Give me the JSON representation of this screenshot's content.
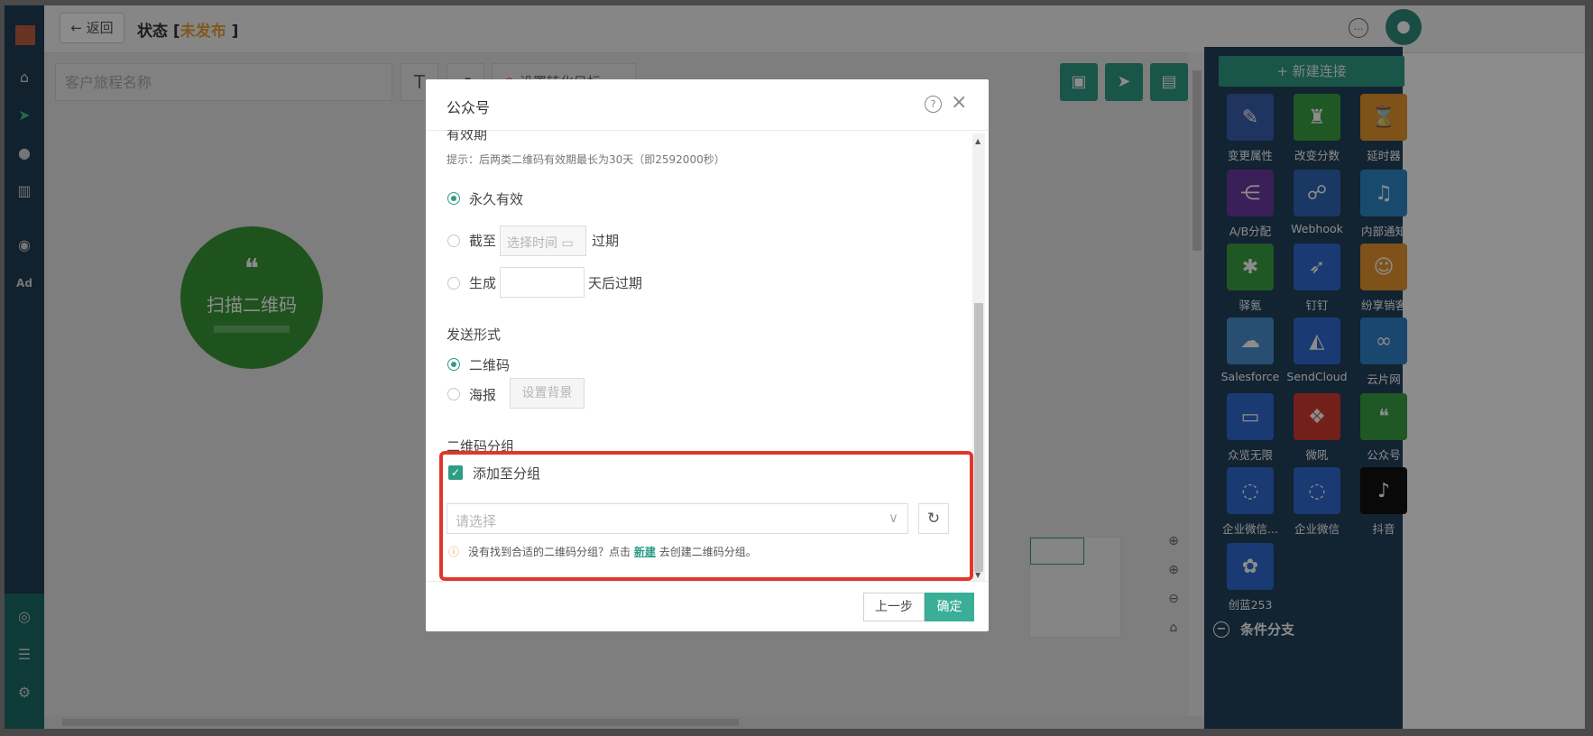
{
  "topbar": {
    "back_label": "返回",
    "status_prefix": "状态 [",
    "status_value": "未发布",
    "status_suffix": "]"
  },
  "toolbar": {
    "journey_name_placeholder": "客户旅程名称",
    "text_tool": "T",
    "goal_label": "设置转化目标"
  },
  "canvas": {
    "node_label": "扫描二维码"
  },
  "right_panel": {
    "new_connection": "+ 新建连接",
    "tiles": [
      {
        "name": "变更属性",
        "color": "#3b5fb0",
        "icon": "edit-icon"
      },
      {
        "name": "改变分数",
        "color": "#3aa043",
        "icon": "trophy-icon"
      },
      {
        "name": "延时器",
        "color": "#e6962c",
        "icon": "hourglass-icon"
      },
      {
        "name": "A/B分配",
        "color": "#6a3aa3",
        "icon": "ab-split-icon"
      },
      {
        "name": "Webhook",
        "color": "#2e66b4",
        "icon": "webhook-icon"
      },
      {
        "name": "内部通知",
        "color": "#2d88c8",
        "icon": "bell-icon"
      },
      {
        "name": "驿氪",
        "color": "#3aa043",
        "icon": "spider-icon"
      },
      {
        "name": "钉钉",
        "color": "#2f6bd1",
        "icon": "dingtalk-icon"
      },
      {
        "name": "纷享销客",
        "color": "#e6962c",
        "icon": "fxiaoke-icon"
      },
      {
        "name": "Salesforce",
        "color": "#4a8fd0",
        "icon": "cloud-icon"
      },
      {
        "name": "SendCloud",
        "color": "#2f6bd1",
        "icon": "sendcloud-icon"
      },
      {
        "name": "云片网",
        "color": "#2f82c8",
        "icon": "link-icon"
      },
      {
        "name": "众览无限",
        "color": "#2f6bd1",
        "icon": "zhonglan-icon"
      },
      {
        "name": "微吼",
        "color": "#d23b32",
        "icon": "vhall-icon"
      },
      {
        "name": "公众号",
        "color": "#3aa043",
        "icon": "wechat-icon"
      },
      {
        "name": "企业微信...",
        "color": "#2f6bd1",
        "icon": "wecom-icon"
      },
      {
        "name": "企业微信",
        "color": "#2f6bd1",
        "icon": "wecom-icon"
      },
      {
        "name": "抖音",
        "color": "#111111",
        "icon": "tiktok-icon"
      },
      {
        "name": "创蓝253",
        "color": "#2f6bd1",
        "icon": "chuanglan-icon"
      }
    ],
    "cond_branch": "条件分支"
  },
  "modal": {
    "title": "公众号",
    "validity_heading": "有效期",
    "validity_hint": "提示：后两类二维码有效期最长为30天（即2592000秒）",
    "opt_forever": "永久有效",
    "opt_until_prefix": "截至",
    "opt_until_placeholder": "选择时间",
    "opt_until_suffix": "过期",
    "opt_gen_prefix": "生成",
    "opt_gen_suffix": "天后过期",
    "send_form_heading": "发送形式",
    "opt_qrcode": "二维码",
    "opt_poster": "海报",
    "set_bg_button": "设置背景",
    "group_heading": "二维码分组",
    "add_to_group": "添加至分组",
    "select_placeholder": "请选择",
    "notice_pre": "没有找到合适的二维码分组？点击",
    "notice_link": "新建",
    "notice_post": "去创建二维码分组。",
    "prev_button": "上一步",
    "ok_button": "确定"
  },
  "colors": {
    "accent": "#2f9c84",
    "highlight": "#e0362c",
    "warning": "#e8a33a"
  }
}
